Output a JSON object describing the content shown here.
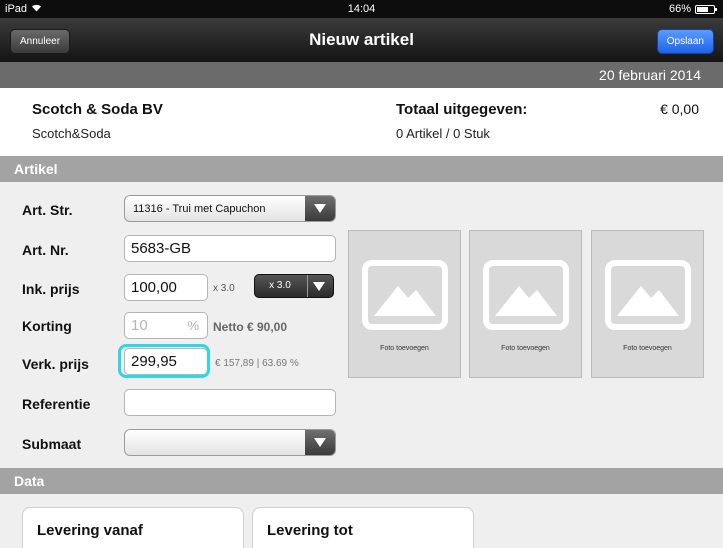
{
  "status_bar": {
    "device": "iPad",
    "time": "14:04",
    "battery": "66%",
    "battery_level": 0.66
  },
  "nav": {
    "cancel_label": "Annuleer",
    "title": "Nieuw artikel",
    "save_label": "Opslaan"
  },
  "date": "20 februari 2014",
  "supplier": {
    "name": "Scotch & Soda BV",
    "brand": "Scotch&Soda"
  },
  "totals": {
    "label": "Totaal uitgegeven:",
    "value": "€ 0,00",
    "summary": "0 Artikel / 0 Stuk"
  },
  "sections": {
    "artikel": "Artikel",
    "data": "Data"
  },
  "form": {
    "art_str": {
      "label": "Art. Str.",
      "value": "11316 - Trui met Capuchon"
    },
    "art_nr": {
      "label": "Art. Nr.",
      "value": "5683-GB"
    },
    "ink_prijs": {
      "label": "Ink. prijs",
      "value": "100,00",
      "multiplier_note": "x 3.0",
      "multiplier_button": "x 3.0"
    },
    "korting": {
      "label": "Korting",
      "placeholder": "10",
      "percent": "%",
      "netto": "Netto € 90,00"
    },
    "verk_prijs": {
      "label": "Verk. prijs",
      "value": "299,95",
      "note": "€ 157,89 | 63.69 %"
    },
    "referentie": {
      "label": "Referentie",
      "value": ""
    },
    "submaat": {
      "label": "Submaat",
      "value": ""
    }
  },
  "photos": [
    {
      "caption": "Foto toevoegen"
    },
    {
      "caption": "Foto toevoegen"
    },
    {
      "caption": "Foto toevoegen"
    }
  ],
  "data_cards": {
    "from_label": "Levering vanaf",
    "to_label": "Levering tot"
  },
  "colors": {
    "accent_blue": "#2b72f0",
    "highlight": "#2fd6e6",
    "section_gray": "#a3a3a3"
  }
}
